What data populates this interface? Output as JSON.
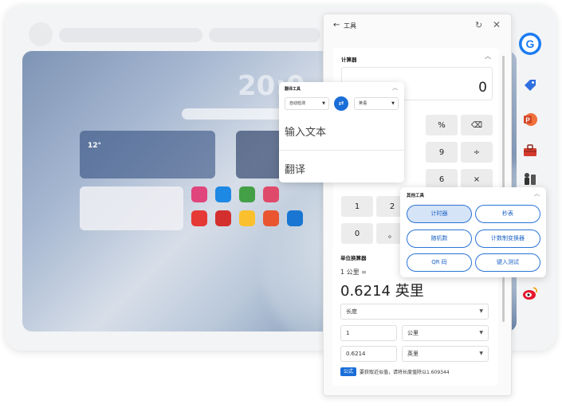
{
  "desktop": {
    "clock": "20:0",
    "weather_temp": "12°"
  },
  "tools_panel": {
    "title": "工具",
    "calculator": {
      "title": "计算器",
      "display": "0",
      "keys": [
        "%",
        "⌫",
        "9",
        "÷",
        "6",
        "×",
        "1",
        "2",
        "0",
        "。"
      ]
    },
    "unit_converter": {
      "title": "单位换算器",
      "input_line": "1 公里 =",
      "result": "0.6214 英里",
      "category": "长度",
      "from_value": "1",
      "from_unit": "公里",
      "to_value": "0.6214",
      "to_unit": "英里",
      "formula_badge": "公式",
      "formula_text": "要获取近似值，请将长度值除以1.609344"
    }
  },
  "translate_popup": {
    "title": "翻译工具",
    "source_lang": "自动检测",
    "target_lang": "英语",
    "input_placeholder": "输入文本",
    "output_label": "翻译"
  },
  "other_tools": {
    "title": "其他工具",
    "buttons": [
      "计时器",
      "秒表",
      "随机数",
      "计数制变换器",
      "QR 码",
      "键入测试"
    ]
  }
}
